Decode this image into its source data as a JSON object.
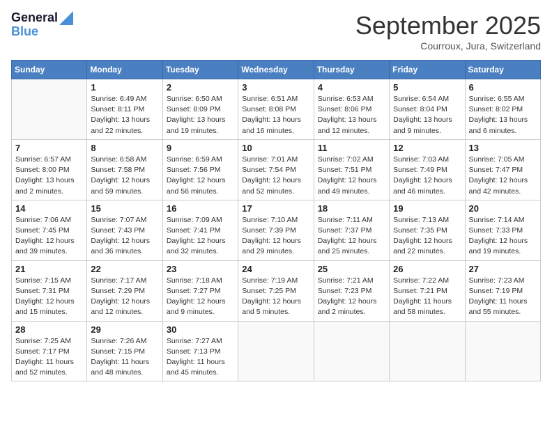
{
  "header": {
    "logo_line1": "General",
    "logo_line2": "Blue",
    "month_title": "September 2025",
    "location": "Courroux, Jura, Switzerland"
  },
  "weekdays": [
    "Sunday",
    "Monday",
    "Tuesday",
    "Wednesday",
    "Thursday",
    "Friday",
    "Saturday"
  ],
  "weeks": [
    [
      {
        "day": "",
        "info": ""
      },
      {
        "day": "1",
        "info": "Sunrise: 6:49 AM\nSunset: 8:11 PM\nDaylight: 13 hours\nand 22 minutes."
      },
      {
        "day": "2",
        "info": "Sunrise: 6:50 AM\nSunset: 8:09 PM\nDaylight: 13 hours\nand 19 minutes."
      },
      {
        "day": "3",
        "info": "Sunrise: 6:51 AM\nSunset: 8:08 PM\nDaylight: 13 hours\nand 16 minutes."
      },
      {
        "day": "4",
        "info": "Sunrise: 6:53 AM\nSunset: 8:06 PM\nDaylight: 13 hours\nand 12 minutes."
      },
      {
        "day": "5",
        "info": "Sunrise: 6:54 AM\nSunset: 8:04 PM\nDaylight: 13 hours\nand 9 minutes."
      },
      {
        "day": "6",
        "info": "Sunrise: 6:55 AM\nSunset: 8:02 PM\nDaylight: 13 hours\nand 6 minutes."
      }
    ],
    [
      {
        "day": "7",
        "info": "Sunrise: 6:57 AM\nSunset: 8:00 PM\nDaylight: 13 hours\nand 2 minutes."
      },
      {
        "day": "8",
        "info": "Sunrise: 6:58 AM\nSunset: 7:58 PM\nDaylight: 12 hours\nand 59 minutes."
      },
      {
        "day": "9",
        "info": "Sunrise: 6:59 AM\nSunset: 7:56 PM\nDaylight: 12 hours\nand 56 minutes."
      },
      {
        "day": "10",
        "info": "Sunrise: 7:01 AM\nSunset: 7:54 PM\nDaylight: 12 hours\nand 52 minutes."
      },
      {
        "day": "11",
        "info": "Sunrise: 7:02 AM\nSunset: 7:51 PM\nDaylight: 12 hours\nand 49 minutes."
      },
      {
        "day": "12",
        "info": "Sunrise: 7:03 AM\nSunset: 7:49 PM\nDaylight: 12 hours\nand 46 minutes."
      },
      {
        "day": "13",
        "info": "Sunrise: 7:05 AM\nSunset: 7:47 PM\nDaylight: 12 hours\nand 42 minutes."
      }
    ],
    [
      {
        "day": "14",
        "info": "Sunrise: 7:06 AM\nSunset: 7:45 PM\nDaylight: 12 hours\nand 39 minutes."
      },
      {
        "day": "15",
        "info": "Sunrise: 7:07 AM\nSunset: 7:43 PM\nDaylight: 12 hours\nand 36 minutes."
      },
      {
        "day": "16",
        "info": "Sunrise: 7:09 AM\nSunset: 7:41 PM\nDaylight: 12 hours\nand 32 minutes."
      },
      {
        "day": "17",
        "info": "Sunrise: 7:10 AM\nSunset: 7:39 PM\nDaylight: 12 hours\nand 29 minutes."
      },
      {
        "day": "18",
        "info": "Sunrise: 7:11 AM\nSunset: 7:37 PM\nDaylight: 12 hours\nand 25 minutes."
      },
      {
        "day": "19",
        "info": "Sunrise: 7:13 AM\nSunset: 7:35 PM\nDaylight: 12 hours\nand 22 minutes."
      },
      {
        "day": "20",
        "info": "Sunrise: 7:14 AM\nSunset: 7:33 PM\nDaylight: 12 hours\nand 19 minutes."
      }
    ],
    [
      {
        "day": "21",
        "info": "Sunrise: 7:15 AM\nSunset: 7:31 PM\nDaylight: 12 hours\nand 15 minutes."
      },
      {
        "day": "22",
        "info": "Sunrise: 7:17 AM\nSunset: 7:29 PM\nDaylight: 12 hours\nand 12 minutes."
      },
      {
        "day": "23",
        "info": "Sunrise: 7:18 AM\nSunset: 7:27 PM\nDaylight: 12 hours\nand 9 minutes."
      },
      {
        "day": "24",
        "info": "Sunrise: 7:19 AM\nSunset: 7:25 PM\nDaylight: 12 hours\nand 5 minutes."
      },
      {
        "day": "25",
        "info": "Sunrise: 7:21 AM\nSunset: 7:23 PM\nDaylight: 12 hours\nand 2 minutes."
      },
      {
        "day": "26",
        "info": "Sunrise: 7:22 AM\nSunset: 7:21 PM\nDaylight: 11 hours\nand 58 minutes."
      },
      {
        "day": "27",
        "info": "Sunrise: 7:23 AM\nSunset: 7:19 PM\nDaylight: 11 hours\nand 55 minutes."
      }
    ],
    [
      {
        "day": "28",
        "info": "Sunrise: 7:25 AM\nSunset: 7:17 PM\nDaylight: 11 hours\nand 52 minutes."
      },
      {
        "day": "29",
        "info": "Sunrise: 7:26 AM\nSunset: 7:15 PM\nDaylight: 11 hours\nand 48 minutes."
      },
      {
        "day": "30",
        "info": "Sunrise: 7:27 AM\nSunset: 7:13 PM\nDaylight: 11 hours\nand 45 minutes."
      },
      {
        "day": "",
        "info": ""
      },
      {
        "day": "",
        "info": ""
      },
      {
        "day": "",
        "info": ""
      },
      {
        "day": "",
        "info": ""
      }
    ]
  ]
}
